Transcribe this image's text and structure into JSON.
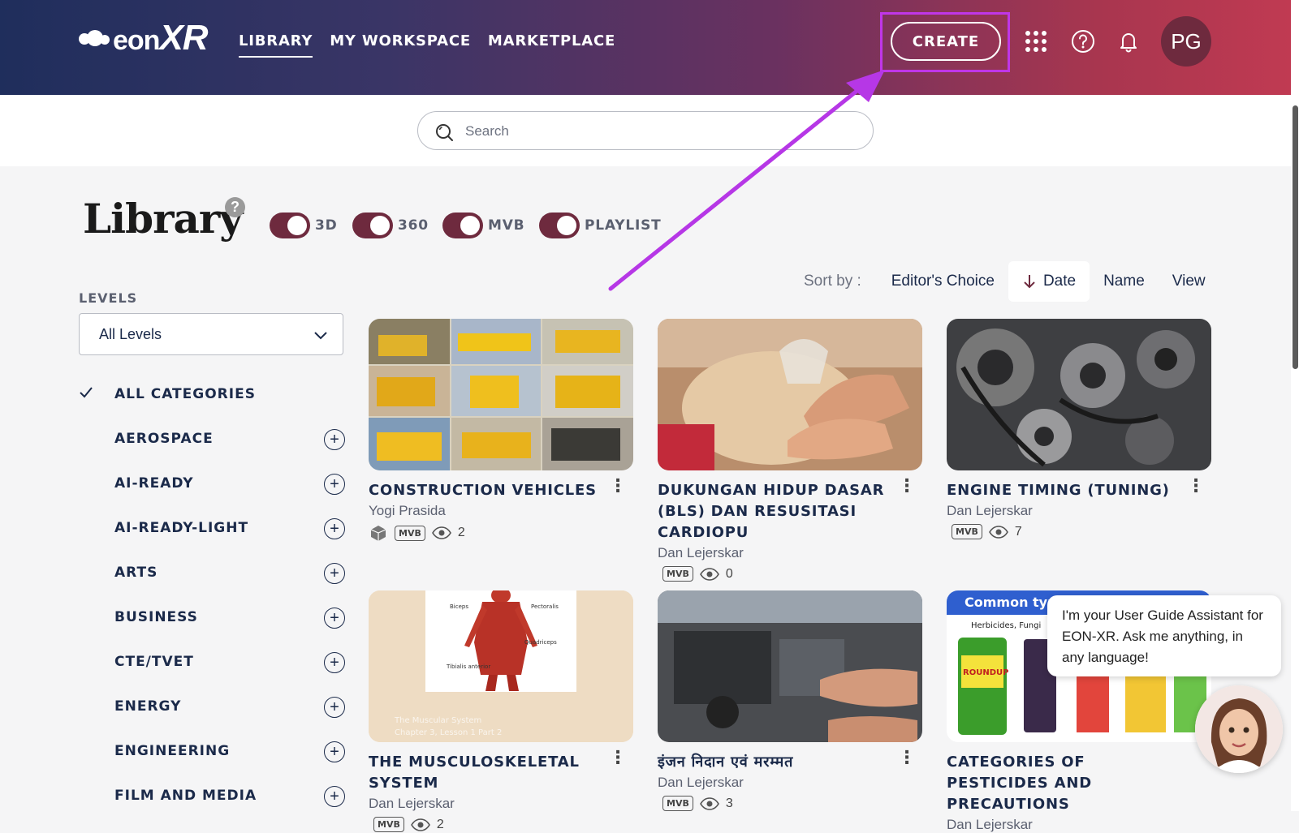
{
  "header": {
    "logo_text": "eon",
    "logo_text_bold": "XR",
    "nav": [
      {
        "label": "LIBRARY",
        "active": true
      },
      {
        "label": "MY WORKSPACE",
        "active": false
      },
      {
        "label": "MARKETPLACE",
        "active": false
      }
    ],
    "create_label": "CREATE",
    "avatar_initials": "PG",
    "icons": [
      "apps-grid-icon",
      "help-icon",
      "bell-icon"
    ]
  },
  "search": {
    "placeholder": "Search"
  },
  "library": {
    "title": "Library",
    "help_glyph": "?",
    "toggles": [
      {
        "label": "3D",
        "on": true
      },
      {
        "label": "360",
        "on": true
      },
      {
        "label": "MVB",
        "on": true
      },
      {
        "label": "PLAYLIST",
        "on": true
      }
    ]
  },
  "sort": {
    "label": "Sort by :",
    "options": [
      "Editor's Choice",
      "Date",
      "Name",
      "View"
    ],
    "active": "Date"
  },
  "levels": {
    "label": "LEVELS",
    "selected": "All Levels"
  },
  "categories": [
    {
      "label": "ALL CATEGORIES",
      "selected": true
    },
    {
      "label": "AEROSPACE"
    },
    {
      "label": "AI-READY"
    },
    {
      "label": "AI-READY-LIGHT"
    },
    {
      "label": "ARTS"
    },
    {
      "label": "BUSINESS"
    },
    {
      "label": "CTE/TVET"
    },
    {
      "label": "ENERGY"
    },
    {
      "label": "ENGINEERING"
    },
    {
      "label": "FILM AND MEDIA"
    }
  ],
  "cards": [
    {
      "title": "CONSTRUCTION VEHICLES",
      "author": "Yogi Prasida",
      "badge": "MVB",
      "views": "2",
      "has_3d": true
    },
    {
      "title": "DUKUNGAN HIDUP DASAR (BLS) DAN RESUSITASI CARDIOPU",
      "author": "Dan Lejerskar",
      "badge": "MVB",
      "views": "0"
    },
    {
      "title": "ENGINE TIMING (TUNING)",
      "author": "Dan Lejerskar",
      "badge": "MVB",
      "views": "7"
    },
    {
      "title": "THE MUSCULOSKELETAL SYSTEM",
      "author": "Dan Lejerskar",
      "badge": "MVB",
      "views": "2",
      "thumb_labels": [
        "Biceps",
        "Pectoralis",
        "Quadriceps",
        "Tibialis anterior",
        "The Muscular System",
        "Chapter 3, Lesson 1 Part 2"
      ]
    },
    {
      "title": "इंजन निदान एवं मरम्मत",
      "author": "Dan Lejerskar",
      "badge": "MVB",
      "views": "3"
    },
    {
      "title": "CATEGORIES OF PESTICIDES AND PRECAUTIONS",
      "author": "Dan Lejerskar",
      "thumb_labels": [
        "Common typ",
        "Herbicides, Fungi",
        "ROUNDUP"
      ]
    }
  ],
  "assistant": {
    "message": "I'm your User Guide Assistant for EON-XR. Ask me anything, in any language!"
  },
  "colors": {
    "accent": "#6e2a3e",
    "highlight": "#c036e8",
    "navy": "#1b2a4a"
  }
}
